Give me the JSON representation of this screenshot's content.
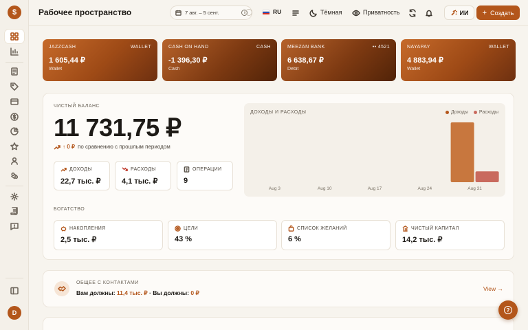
{
  "header": {
    "title": "Рабочее пространство",
    "date_range": "7 авг. – 5 сент.",
    "language": "RU",
    "theme_label": "Тёмная",
    "privacy_label": "Приватность",
    "ai_label": "ИИ",
    "create_label": "Создать"
  },
  "sidebar": {
    "logo": "$",
    "avatar_initial": "D",
    "items": [
      "dashboard-icon",
      "chart-icon",
      "transactions-icon",
      "tag-icon",
      "wallet-icon",
      "dollar-icon",
      "pie-icon",
      "star-icon",
      "user-icon",
      "group-icon",
      "settings-icon",
      "scroll-icon",
      "message-icon"
    ]
  },
  "accounts": [
    {
      "name": "JAZZCASH",
      "type": "WALLET",
      "amount": "1 605,44 ₽",
      "sub": "Wallet"
    },
    {
      "name": "CASH ON HAND",
      "type": "CASH",
      "amount": "-1 396,30 ₽",
      "sub": "Cash"
    },
    {
      "name": "MEEZAN BANK",
      "type": "•• 4521",
      "amount": "6 638,67 ₽",
      "sub": "Debit"
    },
    {
      "name": "NAYAPAY",
      "type": "WALLET",
      "amount": "4 883,94 ₽",
      "sub": "Wallet"
    }
  ],
  "net": {
    "label": "ЧИСТЫЙ БАЛАНС",
    "value": "11 731,75 ₽",
    "change_value": "↑ 0 ₽",
    "change_text": "по сравнению с прошлым периодом"
  },
  "stats": {
    "income": {
      "label": "ДОХОДЫ",
      "value": "22,7 тыс. ₽"
    },
    "expenses": {
      "label": "РАСХОДЫ",
      "value": "4,1 тыс. ₽"
    },
    "operations": {
      "label": "ОПЕРАЦИИ",
      "value": "9"
    }
  },
  "wealth": {
    "label": "БОГАТСТВО",
    "savings": {
      "label": "НАКОПЛЕНИЯ",
      "value": "2,5 тыс. ₽"
    },
    "goals": {
      "label": "ЦЕЛИ",
      "value": "43 %"
    },
    "wishlist": {
      "label": "СПИСОК ЖЕЛАНИЙ",
      "value": "6 %"
    },
    "net_worth": {
      "label": "ЧИСТЫЙ КАПИТАЛ",
      "value": "14,2 тыс. ₽"
    }
  },
  "shared": {
    "title": "ОБЩЕЕ С КОНТАКТАМИ",
    "owe_label": "Вам должны:",
    "owe_value": "11,4 тыс. ₽",
    "you_owe_label": "· Вы должны:",
    "you_owe_value": "0 ₽",
    "view_label": "View →"
  },
  "colors": {
    "accent": "#b3561b",
    "income": "#c8773e",
    "expense": "#c96a5e"
  },
  "chart_data": {
    "type": "bar",
    "title": "ДОХОДЫ И РАСХОДЫ",
    "categories": [
      "Aug 3",
      "Aug 10",
      "Aug 17",
      "Aug 24",
      "Aug 31"
    ],
    "series": [
      {
        "name": "Доходы",
        "values": [
          0,
          0,
          0,
          0,
          22700
        ]
      },
      {
        "name": "Расходы",
        "values": [
          0,
          0,
          0,
          0,
          4100
        ]
      }
    ],
    "ylim": [
      0,
      22700
    ],
    "grid": false,
    "legend": "top-right"
  }
}
